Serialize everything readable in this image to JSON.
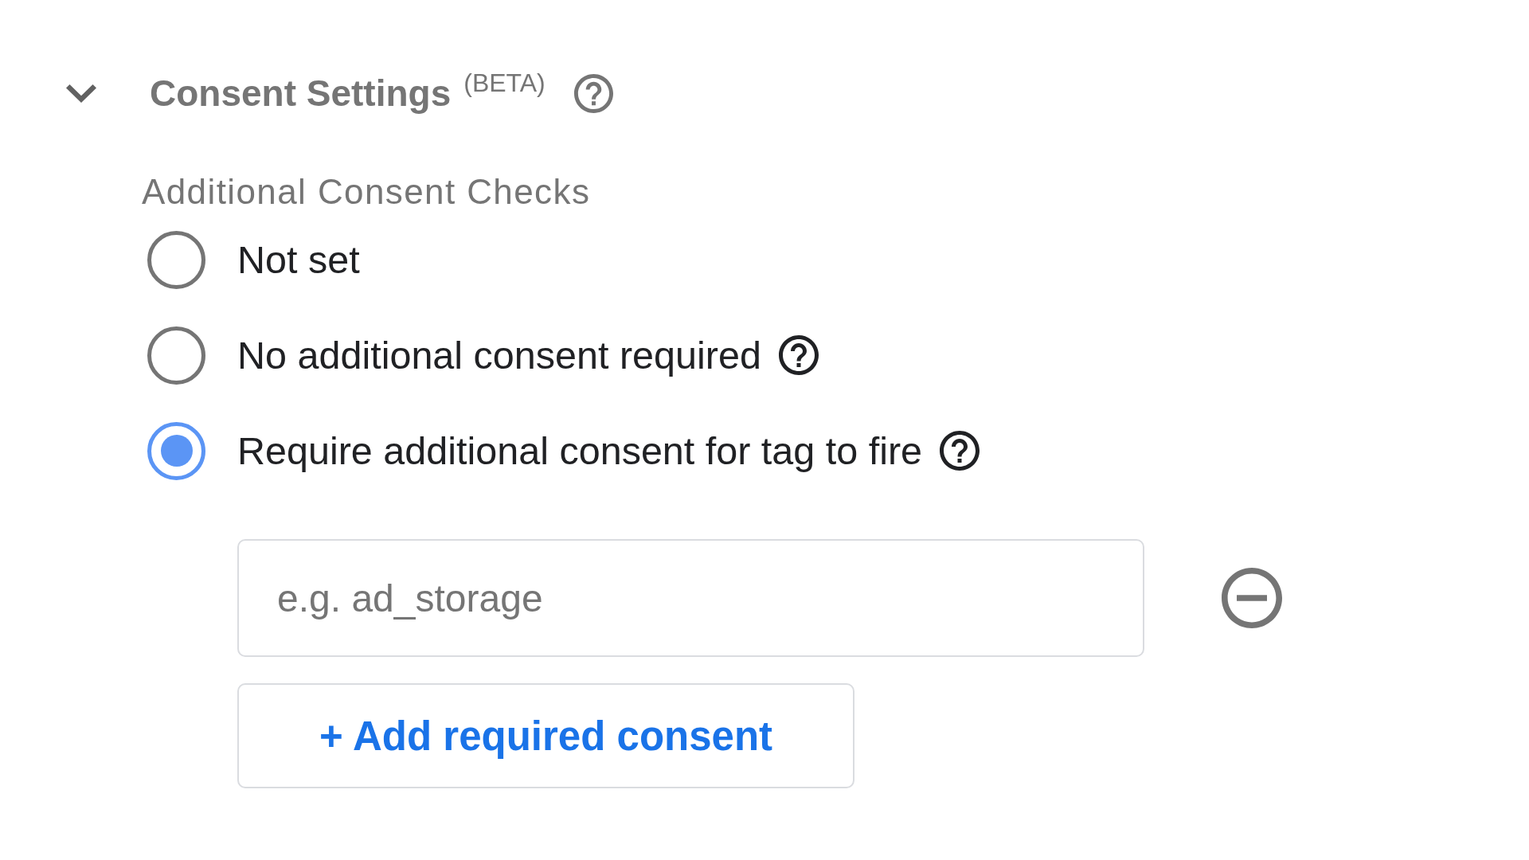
{
  "section": {
    "title": "Consent Settings",
    "badge": "(BETA)",
    "expanded": true,
    "help_icon": true
  },
  "additional_consent_checks": {
    "label": "Additional Consent Checks",
    "options": [
      {
        "label": "Not set",
        "selected": false,
        "help_icon": false
      },
      {
        "label": "No additional consent required",
        "selected": false,
        "help_icon": true
      },
      {
        "label": "Require additional consent for tag to fire",
        "selected": true,
        "help_icon": true
      }
    ],
    "required_consents": [
      {
        "placeholder": "e.g. ad_storage"
      }
    ],
    "add_button": "+ Add required consent"
  }
}
